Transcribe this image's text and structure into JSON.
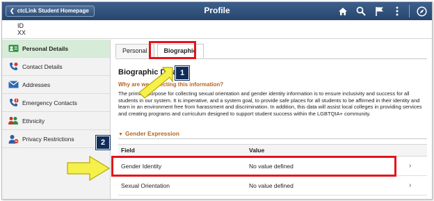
{
  "header": {
    "back_label": "ctcLink Student Homepage",
    "title": "Profile",
    "icons": [
      "home-icon",
      "search-icon",
      "flag-icon",
      "more-options-icon",
      "navbar-icon"
    ]
  },
  "identity": {
    "label": "ID",
    "value": "XX"
  },
  "sidebar": {
    "items": [
      {
        "label": "Personal Details",
        "icon": "id-card-icon",
        "active": true
      },
      {
        "label": "Contact Details",
        "icon": "phone-icon",
        "active": false
      },
      {
        "label": "Addresses",
        "icon": "envelope-icon",
        "active": false
      },
      {
        "label": "Emergency Contacts",
        "icon": "emergency-phone-icon",
        "active": false
      },
      {
        "label": "Ethnicity",
        "icon": "people-icon",
        "active": false
      },
      {
        "label": "Privacy Restrictions",
        "icon": "privacy-person-icon",
        "active": false
      }
    ]
  },
  "tabs": [
    {
      "label": "Personal",
      "selected": false
    },
    {
      "label": "Biographic",
      "selected": true
    }
  ],
  "section": {
    "title": "Biographic Data",
    "why_link": "Why are we collecting this information?",
    "purpose_text": "The primary purpose for collecting sexual orientation and gender identity information is to ensure inclusivity and success for all students in our system. It is imperative, and a system goal, to provide safe places for all students to be affirmed in their identity and learn in an environment free from harassment and discrimination. In addition, this data will assist local colleges in providing services and creating programs and curriculum designed to support student success within the LGBTQIA+ community."
  },
  "gender_expression": {
    "title": "Gender Expression",
    "columns": [
      "Field",
      "Value"
    ],
    "rows": [
      {
        "field": "Gender Identity",
        "value": "No value defined"
      },
      {
        "field": "Sexual Orientation",
        "value": "No value defined"
      }
    ]
  },
  "annotations": {
    "step1": "1",
    "step2": "2"
  },
  "colors": {
    "header_bg": "#27466e",
    "active_nav_bg": "#d7ecd8",
    "highlight_red": "#e4131b",
    "accent_orange": "#b5651d",
    "badge_navy": "#102d5a",
    "arrow_yellow": "#f5f04a"
  }
}
